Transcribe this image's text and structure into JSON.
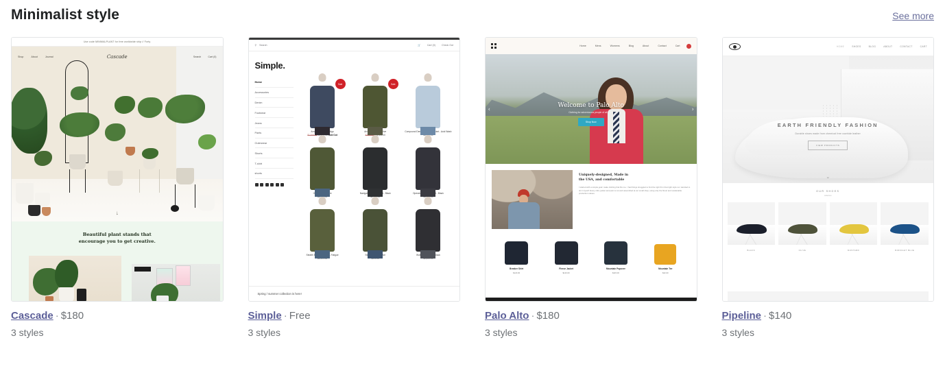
{
  "header": {
    "title": "Minimalist style",
    "see_more": "See more"
  },
  "cards": [
    {
      "name": "Cascade",
      "price": "$180",
      "separator": "·",
      "styles": "3 styles",
      "preview": {
        "announcement": "Use code MINIMALPLANT for free worldwide ship // Forty",
        "nav_left": [
          "Shop",
          "About",
          "Journal"
        ],
        "logo": "Cascade",
        "nav_right": [
          "Search",
          "Cart (0)"
        ],
        "scroll_icon": "↓",
        "headline_line1": "Beautiful plant stands that",
        "headline_line2": "encourage you to get creative."
      }
    },
    {
      "name": "Simple",
      "price": "Free",
      "separator": "·",
      "styles": "3 styles",
      "preview": {
        "search_icon": "search-icon",
        "search_label": "Search",
        "cart_label": "Cart (0)",
        "checkout_label": "Check Out",
        "brand": "Simple.",
        "menu": [
          "Home",
          "Accessories",
          "Denim",
          "Footwear",
          "Jeans",
          "Pants",
          "Outerwear",
          "Shorts",
          "T-shirt",
          "shorts"
        ],
        "social": [
          "facebook-icon",
          "twitter-icon",
          "pinterest-icon",
          "instagram-icon",
          "tumblr-icon",
          "vimeo-icon"
        ],
        "products": [
          {
            "name": "Arrow Shacket - Indigo",
            "old_price": "$1,519.00",
            "price": "$1,499.00",
            "badge": "Sale",
            "status": "Sold Out",
            "color": "#3e4a60"
          },
          {
            "name": "Arrow Shacket - Olive",
            "old_price": "$1,519.00",
            "price": "$1,499.00",
            "badge": "Sale",
            "status": "",
            "color": "#4e5633"
          },
          {
            "name": "Compound Denim Pullover Jacket - Acid Wash",
            "old_price": "",
            "price": "$1,799.00",
            "badge": "",
            "status": "",
            "color": "#b9cbdb"
          },
          {
            "name": "Gulf Jacket - Olive",
            "old_price": "",
            "price": "$1,299.00",
            "badge": "",
            "status": "",
            "color": "#4f5836"
          },
          {
            "name": "Navigator Parka Jacket - Black",
            "old_price": "",
            "price": "$1,999.00",
            "badge": "",
            "status": "",
            "color": "#2b2d2f"
          },
          {
            "name": "Operator Denim Jacket - Black",
            "old_price": "",
            "price": "$1,399.00",
            "badge": "",
            "status": "",
            "color": "#33333a"
          },
          {
            "name": "Stealth Bomber Jacket - Fatigue",
            "old_price": "",
            "price": "$1,399.00",
            "badge": "",
            "status": "",
            "color": "#59603c"
          },
          {
            "name": "Storm Jacket - Olive",
            "old_price": "",
            "price": "$999.00",
            "badge": "",
            "status": "",
            "color": "#4a5237"
          },
          {
            "name": "Wolfpack Jacket - Black",
            "old_price": "",
            "price": "$1,299.00",
            "badge": "",
            "status": "",
            "color": "#2f2f33"
          }
        ],
        "footer_note": "Spring / summer collection is here!"
      }
    },
    {
      "name": "Palo Alto",
      "price": "$180",
      "separator": "·",
      "styles": "3 styles",
      "preview": {
        "logo": "grid-logo-icon",
        "menu": [
          "Home",
          "Mens",
          "Womens",
          "Blog",
          "About",
          "Contact",
          "Cart"
        ],
        "hero_title": "Welcome to Palo Alto",
        "hero_sub": "Clothing for adventurous people of all kinds",
        "hero_button": "Shop Now",
        "prev_arrow": "‹",
        "next_arrow": "›",
        "feature_title_line1": "Uniquely-designed, Made in",
        "feature_title_line2": "the USA, and comfortable",
        "feature_body": "I started with a simple goal: make clothing that fits me. I had things struggled to find the right fit in that right style so I decided to do it myself. Every shirt, jacket and pant is cut and assembled at our small shop, using only the finest and sustainable production values.",
        "products": [
          {
            "name": "Breaker Shirt",
            "price": "$120.00",
            "color": "#1f2633"
          },
          {
            "name": "Fleece Jacket",
            "price": "$140.00",
            "color": "#222833"
          },
          {
            "name": "Mountain Popover",
            "price": "$115.00",
            "color": "#27323d"
          },
          {
            "name": "Mountain Tee",
            "price": "$42.00",
            "color": "#e8a521"
          }
        ]
      }
    },
    {
      "name": "Pipeline",
      "price": "$140",
      "separator": "·",
      "styles": "3 styles",
      "preview": {
        "logo": "eye-logo-icon",
        "menu": [
          "HOME",
          "SHOES",
          "BLOG",
          "ABOUT",
          "CONTACT",
          "CART"
        ],
        "hero_title": "EARTH FRIENDLY FASHION",
        "hero_sub": "Durable shoes made from chemical free cowhide leather",
        "hero_button": "VIEW PRODUCTS",
        "scroll_icon": "⌄",
        "section_title": "OUR SHOES",
        "section_sub": "collection",
        "shoes": [
          {
            "label": "BLACK",
            "color": "#1b1f2b"
          },
          {
            "label": "OLIVE",
            "color": "#4e523a"
          },
          {
            "label": "MUSTARD",
            "color": "#e3c63f"
          },
          {
            "label": "MIDNIGHT BLUE",
            "color": "#1c5288"
          }
        ]
      }
    }
  ]
}
